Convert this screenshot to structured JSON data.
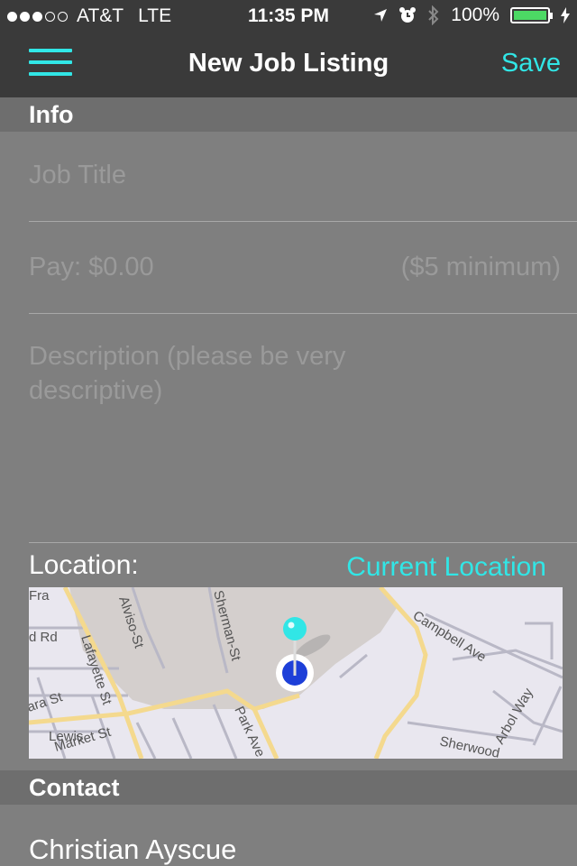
{
  "status_bar": {
    "carrier": "AT&T",
    "network": "LTE",
    "time": "11:35 PM",
    "battery": "100%",
    "signal_dots_full": 3,
    "signal_dots_empty": 2
  },
  "nav": {
    "title": "New Job Listing",
    "save_label": "Save",
    "menu_icon": "hamburger-menu-icon"
  },
  "info_section": {
    "header": "Info",
    "job_title_placeholder": "Job Title",
    "pay_placeholder": "Pay: $0.00",
    "pay_hint": "($5 minimum)",
    "description_placeholder": "Description (please be very descriptive)"
  },
  "location": {
    "label": "Location:",
    "current_location_label": "Current Location",
    "streets": [
      "Alviso St",
      "Sherman St",
      "Lafayette St",
      "Campbell Ave",
      "Market St",
      "Park Ave",
      "Arbol Way",
      "Sherwood",
      "Franklin St",
      "Clara St",
      "Lewis",
      "Rd"
    ]
  },
  "contact_section": {
    "header": "Contact",
    "name": "Christian Ayscue"
  },
  "colors": {
    "accent": "#31e6e6",
    "bar_bg": "#3a3a3a",
    "page_bg": "#7f7f7f",
    "section_bg": "#6e6e6e",
    "battery": "#4cd964"
  }
}
